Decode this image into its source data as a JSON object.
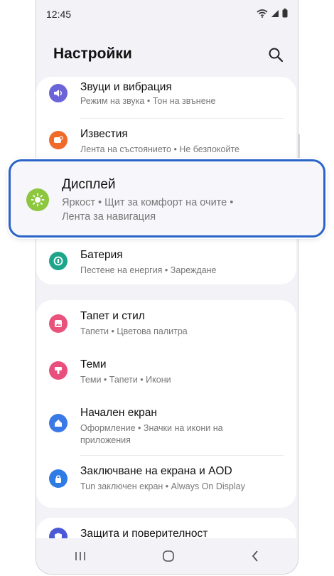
{
  "status": {
    "time": "12:45"
  },
  "header": {
    "title": "Настройки"
  },
  "settings": {
    "sound": {
      "title": "Звуци и вибрация",
      "subtitle": "Режим на звука  •  Тон на звънене",
      "color": "#6a63d9"
    },
    "notifications": {
      "title": "Известия",
      "subtitle": "Лента на състоянието  •  Не безпокойте",
      "color": "#f06a2a"
    },
    "display": {
      "title": "Дисплей",
      "subtitle_line1": "Яркост  •  Щит за комфорт на очите  •",
      "subtitle_line2": "Лента за навигация",
      "color": "#8dc63f"
    },
    "battery": {
      "title": "Батерия",
      "subtitle": "Пестене на енергия  •  Зареждане",
      "color": "#1da58c"
    },
    "wallpaper": {
      "title": "Тапет и стил",
      "subtitle": "Тапети  •  Цветова палитра",
      "color": "#e9527a"
    },
    "themes": {
      "title": "Теми",
      "subtitle": "Теми  •  Тапети  •  Икони",
      "color": "#e84f7d"
    },
    "home": {
      "title": "Начален екран",
      "subtitle_line1": "Оформление  •  Значки на икони на",
      "subtitle_line2": "приложения",
      "color": "#3a7ae6"
    },
    "lock": {
      "title": "Заключване на екрана и AOD",
      "subtitle": "Tun заключен екран  •  Always On Display",
      "color": "#2f7be6"
    },
    "privacy": {
      "title": "Защита и поверителност",
      "color": "#4a5ad6"
    }
  }
}
